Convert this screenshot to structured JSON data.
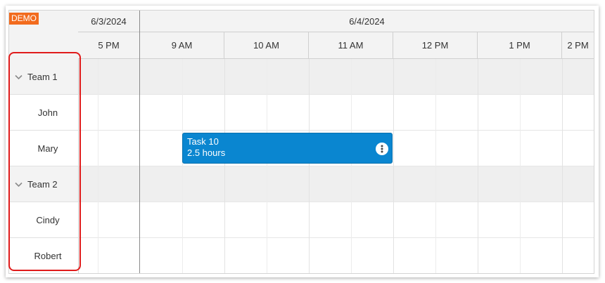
{
  "badge": "DEMO",
  "header": {
    "dates": [
      {
        "label": "6/3/2024"
      },
      {
        "label": "6/4/2024"
      }
    ],
    "hours": [
      "5 PM",
      "9 AM",
      "10 AM",
      "11 AM",
      "12 PM",
      "1 PM",
      "2 PM"
    ]
  },
  "rows": [
    {
      "type": "group",
      "label": "Team 1",
      "icon": "chevron-down-icon"
    },
    {
      "type": "resource",
      "label": "John"
    },
    {
      "type": "resource",
      "label": "Mary"
    },
    {
      "type": "group",
      "label": "Team 2",
      "icon": "chevron-down-icon"
    },
    {
      "type": "resource",
      "label": "Cindy"
    },
    {
      "type": "resource",
      "label": "Robert"
    }
  ],
  "event": {
    "title": "Task 10",
    "duration": "2.5 hours",
    "color": "#0a86d0",
    "menu_icon": "more-vertical-icon"
  },
  "colors": {
    "badge": "#f26b1d",
    "highlight": "#e01b1b",
    "group_row": "#efefef"
  }
}
